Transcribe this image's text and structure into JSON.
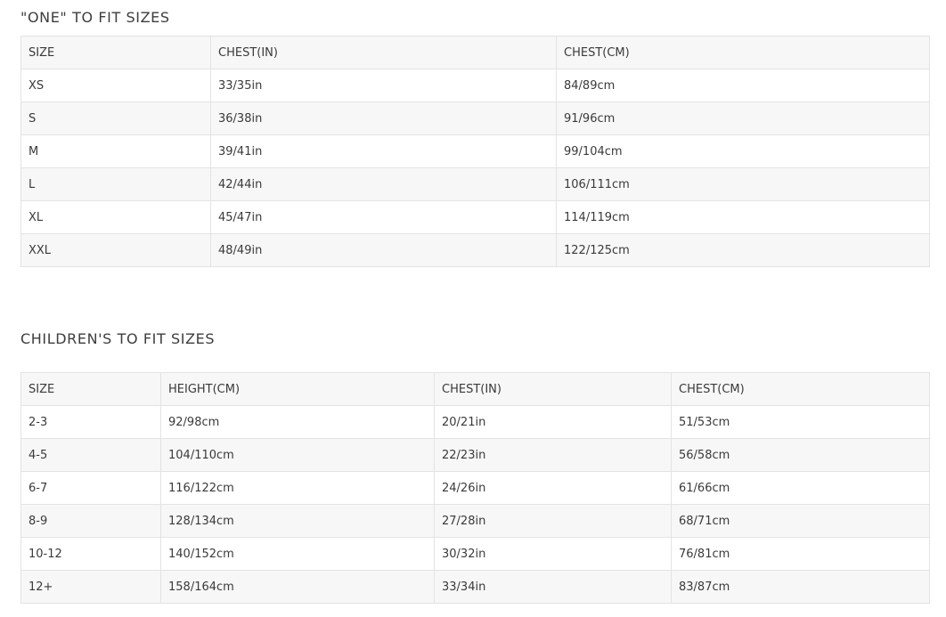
{
  "adult_section": {
    "title": "\"ONE\" TO FIT SIZES",
    "headers": [
      "SIZE",
      "CHEST(IN)",
      "CHEST(CM)"
    ],
    "rows": [
      [
        "XS",
        "33/35in",
        "84/89cm"
      ],
      [
        "S",
        "36/38in",
        "91/96cm"
      ],
      [
        "M",
        "39/41in",
        "99/104cm"
      ],
      [
        "L",
        "42/44in",
        "106/111cm"
      ],
      [
        "XL",
        "45/47in",
        "114/119cm"
      ],
      [
        "XXL",
        "48/49in",
        "122/125cm"
      ]
    ]
  },
  "children_section": {
    "title": "CHILDREN'S TO FIT SIZES",
    "headers": [
      "SIZE",
      "HEIGHT(CM)",
      "CHEST(IN)",
      "CHEST(CM)"
    ],
    "rows": [
      [
        "2-3",
        "92/98cm",
        "20/21in",
        "51/53cm"
      ],
      [
        "4-5",
        "104/110cm",
        "22/23in",
        "56/58cm"
      ],
      [
        "6-7",
        "116/122cm",
        "24/26in",
        "61/66cm"
      ],
      [
        "8-9",
        "128/134cm",
        "27/28in",
        "68/71cm"
      ],
      [
        "10-12",
        "140/152cm",
        "30/32in",
        "76/81cm"
      ],
      [
        "12+",
        "158/164cm",
        "33/34in",
        "83/87cm"
      ]
    ]
  }
}
